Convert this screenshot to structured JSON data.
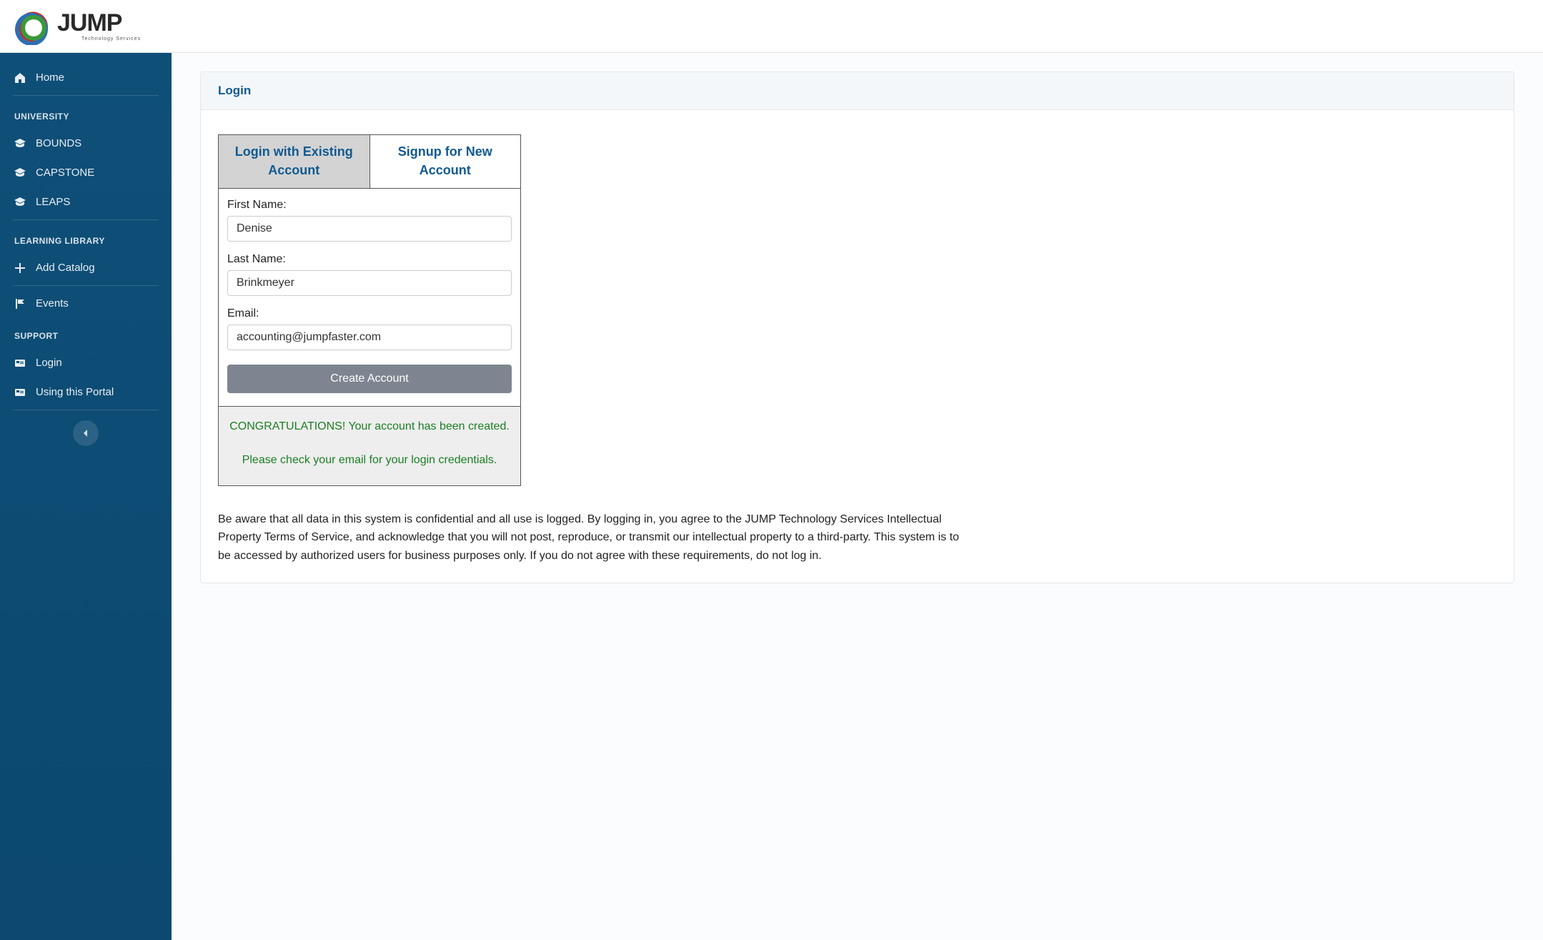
{
  "brand": {
    "name": "JUMP",
    "tagline": "Technology Services"
  },
  "sidebar": {
    "home": "Home",
    "sections": {
      "university": {
        "heading": "UNIVERSITY",
        "items": [
          "BOUNDS",
          "CAPSTONE",
          "LEAPS"
        ]
      },
      "learning_library": {
        "heading": "LEARNING LIBRARY",
        "add_catalog": "Add Catalog",
        "events": "Events"
      },
      "support": {
        "heading": "SUPPORT",
        "login": "Login",
        "using_portal": "Using this Portal"
      }
    }
  },
  "page": {
    "title": "Login"
  },
  "tabs": {
    "login": "Login with Existing Account",
    "signup": "Signup for New Account"
  },
  "form": {
    "first_name_label": "First Name:",
    "first_name_value": "Denise",
    "last_name_label": "Last Name:",
    "last_name_value": "Brinkmeyer",
    "email_label": "Email:",
    "email_value": "accounting@jumpfaster.com",
    "submit_label": "Create Account"
  },
  "success": {
    "line1": "CONGRATULATIONS! Your account has been created.",
    "line2": "Please check your email for your login credentials."
  },
  "disclaimer": "Be aware that all data in this system is confidential and all use is logged.  By logging in, you agree to the JUMP Technology Services Intellectual Property Terms of Service, and acknowledge that you will not post, reproduce, or transmit our intellectual property to a third-party.  This system is to be accessed by authorized users for business purposes only.  If you do not agree with these requirements, do not log in."
}
